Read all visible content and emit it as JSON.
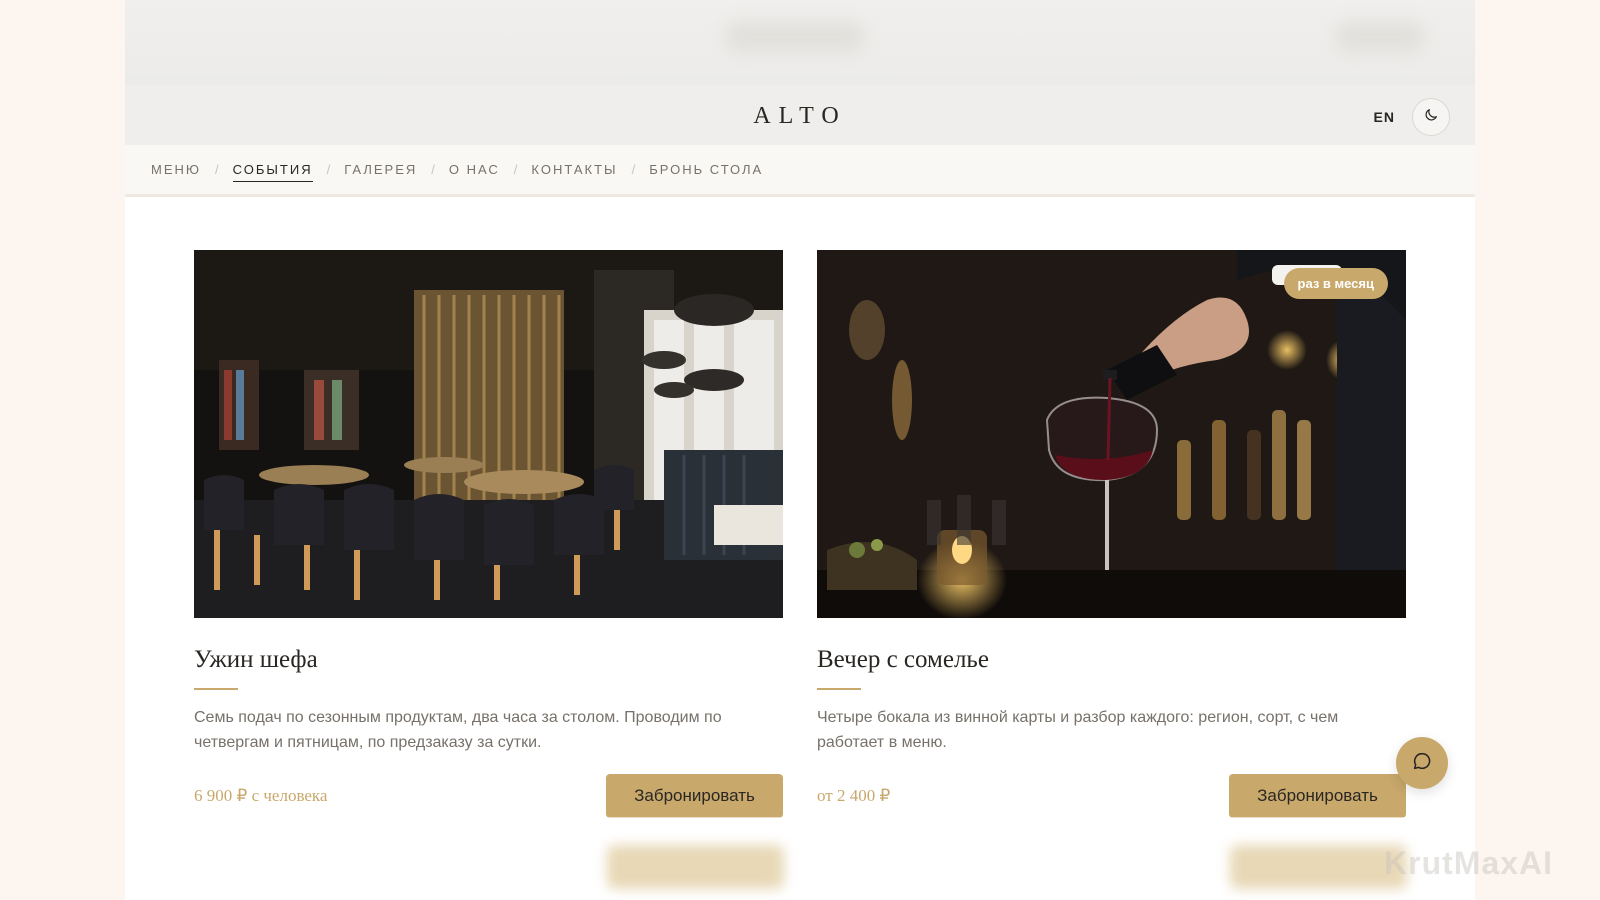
{
  "header": {
    "logo": "ALTO",
    "lang": "EN"
  },
  "nav": {
    "items": [
      {
        "label": "МЕНЮ",
        "active": false
      },
      {
        "label": "СОБЫТИЯ",
        "active": true
      },
      {
        "label": "ГАЛЕРЕЯ",
        "active": false
      },
      {
        "label": "О НАС",
        "active": false
      },
      {
        "label": "КОНТАКТЫ",
        "active": false
      },
      {
        "label": "БРОНЬ СТОЛА",
        "active": false
      }
    ],
    "separator": "/"
  },
  "events": [
    {
      "title": "Ужин шефа",
      "description": "Семь подач по сезонным продуктам, два часа за столом. Проводим по четвергам и пятницам, по предзаказу за сутки.",
      "price": "6 900 ₽ с человека",
      "button": "Забронировать",
      "image": "restaurant-interior"
    },
    {
      "title": "Вечер с сомелье",
      "description": "Четыре бокала из винной карты и разбор каждого: регион, сорт, с чем работает в меню.",
      "price": "от 2 400 ₽",
      "button": "Забронировать",
      "badge": "раз в месяц",
      "image": "wine-pouring"
    }
  ],
  "watermark": "KrutMaxAI",
  "colors": {
    "accent": "#c8a86b",
    "text": "#2a2723",
    "muted": "#77716a",
    "page_bg": "#fcf5f0"
  },
  "icons": {
    "theme": "moon-icon",
    "chat": "chat-bubble-icon"
  }
}
